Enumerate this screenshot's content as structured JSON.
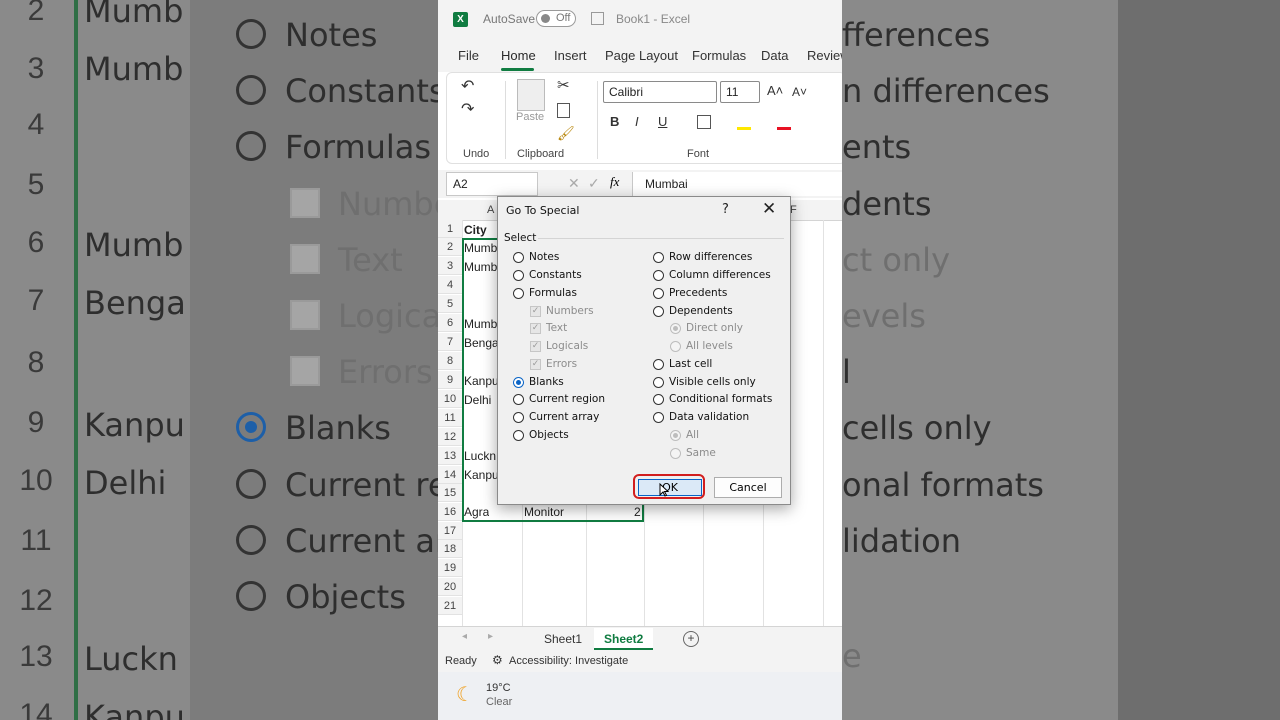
{
  "background": {
    "row_numbers": [
      "2",
      "3",
      "4",
      "5",
      "6",
      "7",
      "8",
      "9",
      "10",
      "11",
      "12",
      "13",
      "14"
    ],
    "left_cells": [
      "Mumb",
      "Mumb",
      "Mumb",
      "Benga",
      "Kanpu",
      "Delhi",
      "Luckn",
      "Kanpu"
    ],
    "mid_options": [
      "Notes",
      "Constants",
      "Formulas",
      "Numbe",
      "Text",
      "Logica",
      "Errors",
      "Blanks",
      "Current re",
      "Current ar",
      "Objects"
    ],
    "right_options": [
      "fferences",
      "n differences",
      "ents",
      "dents",
      "ct only",
      "evels",
      "l",
      "cells only",
      "onal formats",
      "lidation",
      "e"
    ]
  },
  "excel": {
    "autosave_label": "AutoSave",
    "toggle_state": "Off",
    "doc_title": "Book1 - Excel",
    "menu": [
      "File",
      "Home",
      "Insert",
      "Page Layout",
      "Formulas",
      "Data",
      "Review"
    ],
    "ribbon": {
      "undo_label": "Undo",
      "clipboard_label": "Clipboard",
      "paste_label": "Paste",
      "font_label": "Font",
      "font_name": "Calibri",
      "font_size": "11",
      "bold": "B",
      "italic": "I",
      "underline": "U",
      "grow": "A˄",
      "shrink": "A˅"
    },
    "name_box": "A2",
    "formula_value": "Mumbai",
    "fx": "fx",
    "columns": [
      "A",
      "F"
    ],
    "rows": [
      "1",
      "2",
      "3",
      "4",
      "5",
      "6",
      "7",
      "8",
      "9",
      "10",
      "11",
      "12",
      "13",
      "14",
      "15",
      "16",
      "17",
      "18",
      "19",
      "20",
      "21"
    ],
    "cells": {
      "a1": "City",
      "a2": "Mumb",
      "a3": "Mumb",
      "a6": "Mumb",
      "a7": "Benga",
      "a9": "Kanpu",
      "a10": "Delhi",
      "a13": "Luckn",
      "a14": "Kanpu",
      "a16": "Agra",
      "b16": "Monitor",
      "c16": "2"
    },
    "sheets": [
      "Sheet1",
      "Sheet2"
    ],
    "status_ready": "Ready",
    "accessibility": "Accessibility: Investigate",
    "weather_temp": "19°C",
    "weather_desc": "Clear"
  },
  "dialog": {
    "title": "Go To Special",
    "help": "?",
    "close": "✕",
    "section": "Select",
    "left_options": [
      {
        "label": "Notes",
        "state": "off"
      },
      {
        "label": "Constants",
        "state": "off"
      },
      {
        "label": "Formulas",
        "state": "off"
      },
      {
        "label": "Numbers",
        "state": "checked-disabled"
      },
      {
        "label": "Text",
        "state": "checked-disabled"
      },
      {
        "label": "Logicals",
        "state": "checked-disabled"
      },
      {
        "label": "Errors",
        "state": "checked-disabled"
      },
      {
        "label": "Blanks",
        "state": "selected"
      },
      {
        "label": "Current region",
        "state": "off"
      },
      {
        "label": "Current array",
        "state": "off"
      },
      {
        "label": "Objects",
        "state": "off"
      }
    ],
    "right_options": [
      {
        "label": "Row differences",
        "state": "off"
      },
      {
        "label": "Column differences",
        "state": "off"
      },
      {
        "label": "Precedents",
        "state": "off"
      },
      {
        "label": "Dependents",
        "state": "off"
      },
      {
        "label": "Direct only",
        "state": "disabled"
      },
      {
        "label": "All levels",
        "state": "disabled"
      },
      {
        "label": "Last cell",
        "state": "off"
      },
      {
        "label": "Visible cells only",
        "state": "off"
      },
      {
        "label": "Conditional formats",
        "state": "off"
      },
      {
        "label": "Data validation",
        "state": "off"
      },
      {
        "label": "All",
        "state": "disabled"
      },
      {
        "label": "Same",
        "state": "disabled"
      }
    ],
    "ok_label": "OK",
    "cancel_label": "Cancel",
    "highlight_color": "#d21e1e"
  }
}
